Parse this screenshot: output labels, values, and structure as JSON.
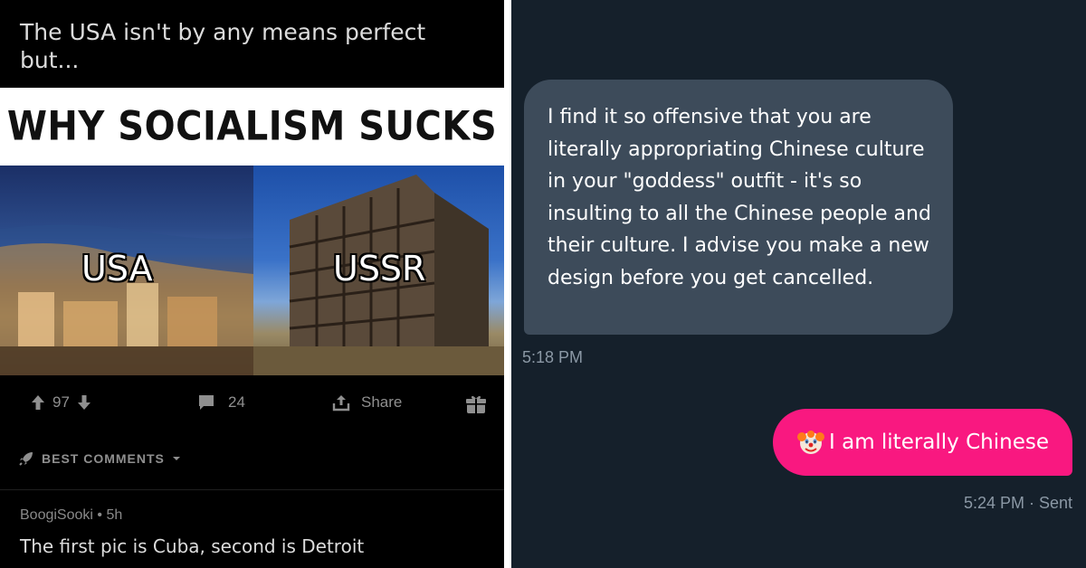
{
  "post": {
    "title": "The USA isn't by any means perfect but...",
    "meme": {
      "heading": "WHY SOCIALISM SUCKS",
      "left_label": "USA",
      "right_label": "USSR"
    },
    "actions": {
      "upvotes": "97",
      "comments": "24",
      "share_label": "Share"
    },
    "comments_sort_label": "BEST COMMENTS",
    "comment": {
      "author": "BoogiSooki",
      "age": "5h",
      "text": "The first pic is Cuba, second is Detroit"
    }
  },
  "chat": {
    "incoming": {
      "text": "I find it so offensive that you are literally appropriating Chinese culture in your \"goddess\" outfit - it's so insulting to all the Chinese people and their culture. I advise you make a new design before you get cancelled.",
      "time": "5:18 PM"
    },
    "outgoing": {
      "emoji": "clown-face",
      "text": "I am literally Chinese",
      "time": "5:24 PM · Sent"
    }
  },
  "colors": {
    "reddit_bg": "#000000",
    "chat_bg": "#15202b",
    "incoming_bubble": "#3d4b5a",
    "outgoing_bubble": "#f91880"
  }
}
